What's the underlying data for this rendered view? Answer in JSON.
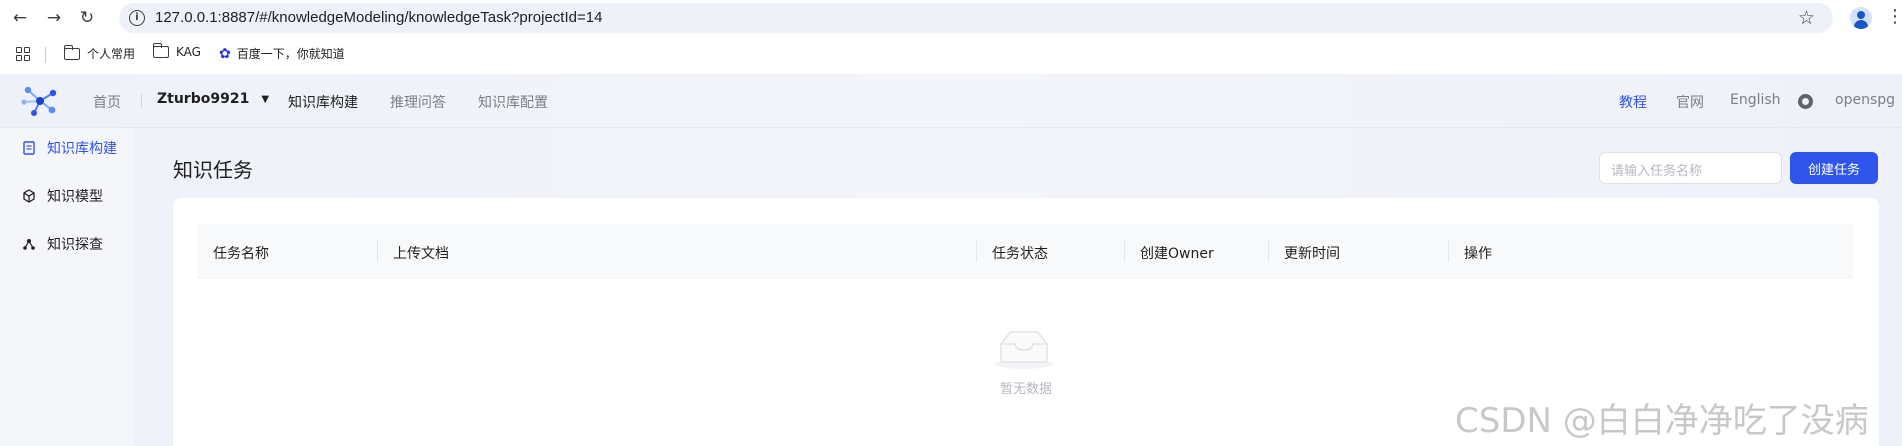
{
  "browser": {
    "url": "127.0.0.1:8887/#/knowledgeModeling/knowledgeTask?projectId=14",
    "bookmarks": [
      {
        "label": "个人常用",
        "icon": "folder-icon"
      },
      {
        "label": "KAG",
        "icon": "folder-icon"
      },
      {
        "label": "百度一下，你就知道",
        "icon": "baidu-paw-icon"
      }
    ]
  },
  "topnav": {
    "home": "首页",
    "project": "Zturbo9921",
    "links": [
      "知识库构建",
      "推理问答",
      "知识库配置"
    ],
    "active_link": "知识库构建",
    "right_links": [
      "教程",
      "官网",
      "English"
    ],
    "github_label": "openspg"
  },
  "sidebar": {
    "items": [
      {
        "label": "知识库构建",
        "icon": "document-icon",
        "active": true
      },
      {
        "label": "知识模型",
        "icon": "cube-icon",
        "active": false
      },
      {
        "label": "知识探查",
        "icon": "graph-icon",
        "active": false
      }
    ]
  },
  "main": {
    "title": "知识任务",
    "search_placeholder": "请输入任务名称",
    "create_button": "创建任务",
    "columns": [
      "任务名称",
      "上传文档",
      "任务状态",
      "创建Owner",
      "更新时间",
      "操作"
    ],
    "empty_text": "暂无数据"
  },
  "watermark": "CSDN @白白净净吃了没病",
  "colors": {
    "accent": "#2f54eb"
  }
}
